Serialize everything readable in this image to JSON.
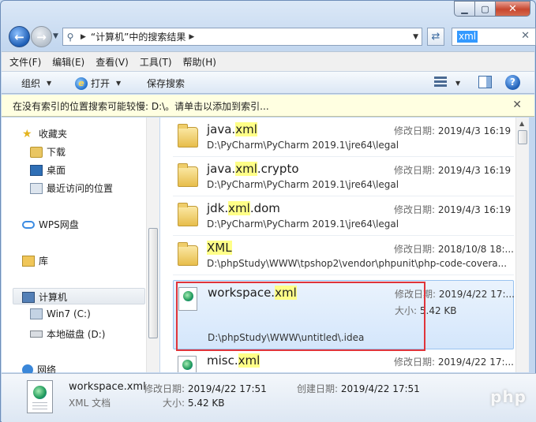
{
  "address": {
    "crumb": "“计算机”中的搜索结果",
    "search_value": "xml"
  },
  "menu": [
    "文件(F)",
    "编辑(E)",
    "查看(V)",
    "工具(T)",
    "帮助(H)"
  ],
  "toolbar": {
    "organize": "组织",
    "open": "打开",
    "save_search": "保存搜索"
  },
  "infobar": {
    "text": "在没有索引的位置搜索可能较慢: D:\\。请单击以添加到索引..."
  },
  "nav": {
    "favorites": "收藏夹",
    "downloads": "下载",
    "desktop": "桌面",
    "recent": "最近访问的位置",
    "wps": "WPS网盘",
    "libraries": "库",
    "computer": "计算机",
    "drive_c": "Win7 (C:)",
    "drive_d": "本地磁盘 (D:)",
    "network": "网络"
  },
  "labels": {
    "modified": "修改日期:",
    "size": "大小:"
  },
  "results": [
    {
      "pre": "java.",
      "hl": "xml",
      "post": "",
      "path": "D:\\PyCharm\\PyCharm 2019.1\\jre64\\legal",
      "date": "2019/4/3 16:19",
      "icon": "folder-icon"
    },
    {
      "pre": "java.",
      "hl": "xml",
      "post": ".crypto",
      "path": "D:\\PyCharm\\PyCharm 2019.1\\jre64\\legal",
      "date": "2019/4/3 16:19",
      "icon": "folder-icon"
    },
    {
      "pre": "jdk.",
      "hl": "xml",
      "post": ".dom",
      "path": "D:\\PyCharm\\PyCharm 2019.1\\jre64\\legal",
      "date": "2019/4/3 16:19",
      "icon": "folder-icon"
    },
    {
      "pre": "",
      "hl": "XML",
      "post": "",
      "path": "D:\\phpStudy\\WWW\\tpshop2\\vendor\\phpunit\\php-code-covera...",
      "date": "2018/10/8 18:...",
      "icon": "folder-icon"
    },
    {
      "pre": "workspace.",
      "hl": "xml",
      "post": "",
      "path": "D:\\phpStudy\\WWW\\untitled\\.idea",
      "date": "2019/4/22 17:...",
      "size": "5.42 KB",
      "icon": "xml-file-icon"
    },
    {
      "pre": "misc.",
      "hl": "xml",
      "post": "",
      "date": "2019/4/22 17:...",
      "icon": "xml-file-icon"
    }
  ],
  "details": {
    "filename": "workspace.xml",
    "type": "XML 文档",
    "modified_label": "修改日期:",
    "modified": "2019/4/22 17:51",
    "created_label": "创建日期:",
    "created": "2019/4/22 17:51",
    "size_label": "大小:",
    "size": "5.42 KB"
  },
  "watermark": "php",
  "colors": {
    "highlight": "#ffff88",
    "selection": "#d4e6fb",
    "annotation": "#e0343a"
  }
}
